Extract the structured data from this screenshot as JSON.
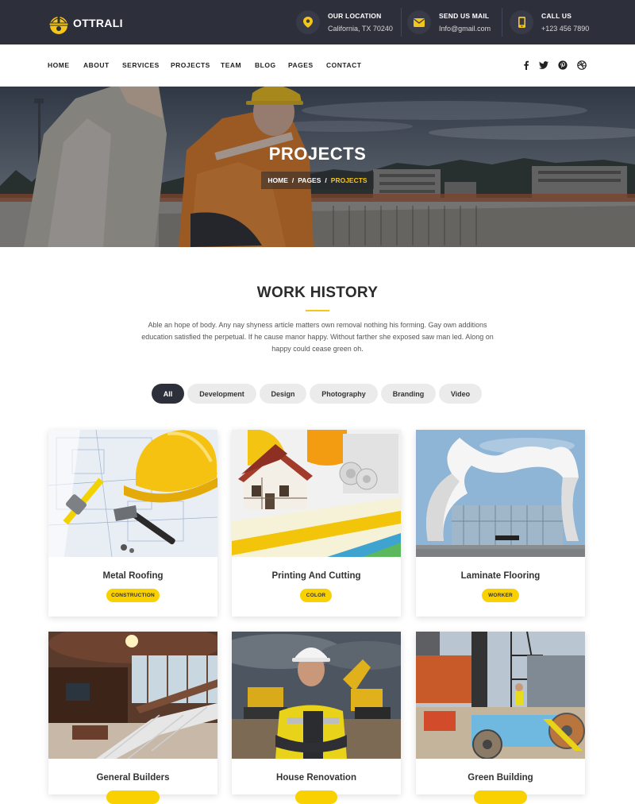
{
  "brand": {
    "name": "OTTRALI",
    "accent": "#f5c518",
    "dark": "#2d2f3b"
  },
  "header": {
    "contacts": [
      {
        "title": "OUR LOCATION",
        "value": "California, TX 70240",
        "icon": "location-pin-icon"
      },
      {
        "title": "SEND US MAIL",
        "value": "Info@gmail.com",
        "icon": "envelope-icon"
      },
      {
        "title": "CALL US",
        "value": "+123 456 7890",
        "icon": "phone-icon"
      }
    ]
  },
  "nav": {
    "items": [
      "HOME",
      "ABOUT",
      "SERVICES",
      "PROJECTS",
      "TEAM",
      "BLOG",
      "PAGES",
      "CONTACT"
    ],
    "social": [
      "facebook-icon",
      "twitter-icon",
      "pinterest-icon",
      "dribbble-icon"
    ]
  },
  "hero": {
    "title": "PROJECTS",
    "breadcrumb": [
      "HOME",
      "PAGES",
      "PROJECTS"
    ]
  },
  "work": {
    "title": "WORK HISTORY",
    "description": "Able an hope of body. Any nay shyness article matters own removal nothing his forming. Gay own additions education satisfied the perpetual. If he cause manor happy. Without farther she exposed saw man led. Along on happy could cease green oh.",
    "filters": [
      "All",
      "Development",
      "Design",
      "Photography",
      "Branding",
      "Video"
    ],
    "active_filter": "All"
  },
  "projects": [
    {
      "title": "Metal Roofing",
      "tag": "CONSTRUCTION"
    },
    {
      "title": "Printing And Cutting",
      "tag": "COLOR"
    },
    {
      "title": "Laminate Flooring",
      "tag": "WORKER"
    },
    {
      "title": "General Builders",
      "tag": ""
    },
    {
      "title": "House Renovation",
      "tag": ""
    },
    {
      "title": "Green Building",
      "tag": ""
    }
  ]
}
